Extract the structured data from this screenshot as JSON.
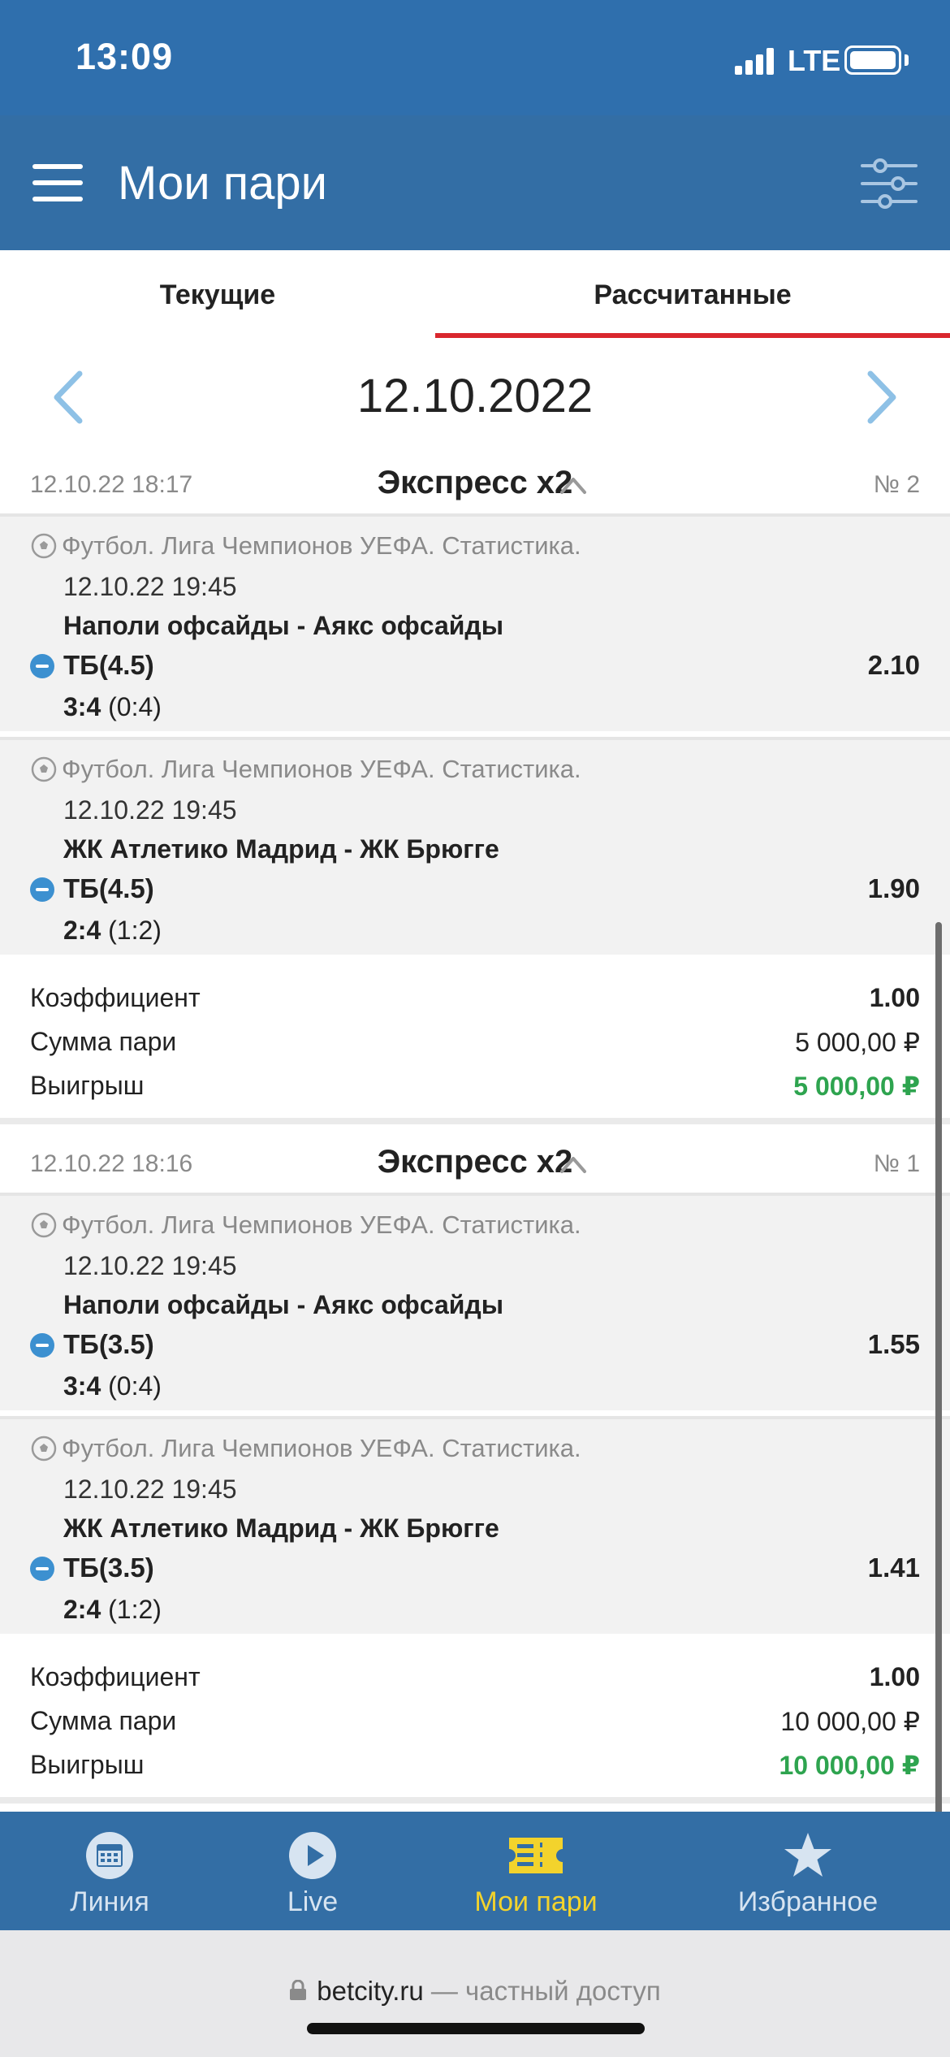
{
  "status_bar": {
    "time": "13:09",
    "network": "LTE"
  },
  "header": {
    "title": "Мои пари"
  },
  "tabs": [
    {
      "label": "Текущие",
      "active": false
    },
    {
      "label": "Рассчитанные",
      "active": true
    }
  ],
  "date_nav": {
    "date": "12.10.2022"
  },
  "bets": [
    {
      "time": "12.10.22 18:17",
      "type": "Экспресс x2",
      "number": "№ 2",
      "events": [
        {
          "league": "Футбол. Лига Чемпионов УЕФА. Статистика.",
          "date": "12.10.22 19:45",
          "teams": "Наполи офсайды - Аякс офсайды",
          "market": "ТБ(4.5)",
          "odds": "2.10",
          "score": "3:4",
          "half": "(0:4)"
        },
        {
          "league": "Футбол. Лига Чемпионов УЕФА. Статистика.",
          "date": "12.10.22 19:45",
          "teams": "ЖК Атлетико Мадрид - ЖК Брюгге",
          "market": "ТБ(4.5)",
          "odds": "1.90",
          "score": "2:4",
          "half": "(1:2)"
        }
      ],
      "summary": {
        "coef_label": "Коэффициент",
        "coef": "1.00",
        "stake_label": "Сумма пари",
        "stake": "5 000,00 ₽",
        "win_label": "Выигрыш",
        "win": "5 000,00 ₽"
      }
    },
    {
      "time": "12.10.22 18:16",
      "type": "Экспресс x2",
      "number": "№ 1",
      "events": [
        {
          "league": "Футбол. Лига Чемпионов УЕФА. Статистика.",
          "date": "12.10.22 19:45",
          "teams": "Наполи офсайды - Аякс офсайды",
          "market": "ТБ(3.5)",
          "odds": "1.55",
          "score": "3:4",
          "half": "(0:4)"
        },
        {
          "league": "Футбол. Лига Чемпионов УЕФА. Статистика.",
          "date": "12.10.22 19:45",
          "teams": "ЖК Атлетико Мадрид - ЖК Брюгге",
          "market": "ТБ(3.5)",
          "odds": "1.41",
          "score": "2:4",
          "half": "(1:2)"
        }
      ],
      "summary": {
        "coef_label": "Коэффициент",
        "coef": "1.00",
        "stake_label": "Сумма пари",
        "stake": "10 000,00 ₽",
        "win_label": "Выигрыш",
        "win": "10 000,00 ₽"
      }
    }
  ],
  "bottom_nav": [
    {
      "label": "Линия",
      "icon": "calendar-icon",
      "active": false
    },
    {
      "label": "Live",
      "icon": "play-icon",
      "active": false
    },
    {
      "label": "Мои пари",
      "icon": "ticket-icon",
      "active": true
    },
    {
      "label": "Избранное",
      "icon": "star-icon",
      "active": false
    }
  ],
  "browser": {
    "domain": "betcity.ru",
    "note": "— частный доступ"
  },
  "colors": {
    "header": "#336ea5",
    "accent_tab": "#d9272e",
    "win": "#2ea44f",
    "nav_active": "#f3d32c",
    "arrow": "#8ec1e6"
  }
}
